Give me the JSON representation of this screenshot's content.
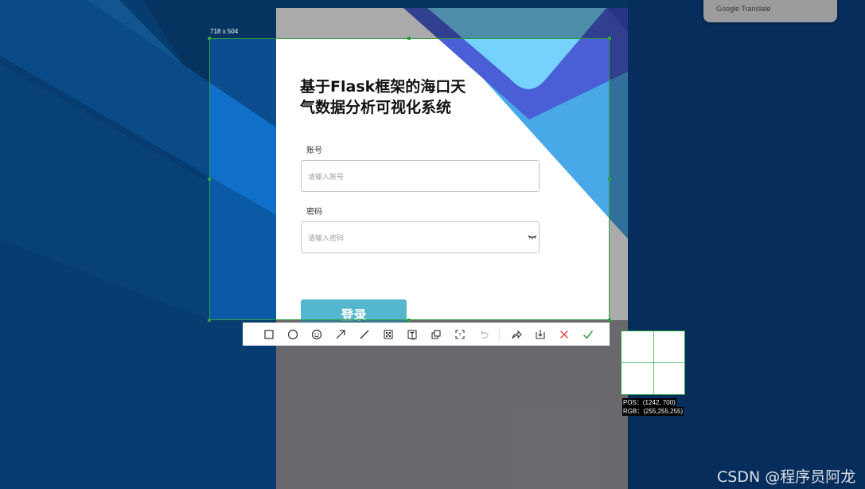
{
  "translate_popup": {
    "label": "Google Translate"
  },
  "login": {
    "title": "基于Flask框架的海口天气数据分析可视化系统",
    "account_label": "账号",
    "account_placeholder": "请输入账号",
    "password_label": "密码",
    "password_placeholder": "请输入密码",
    "submit_label": "登录"
  },
  "capture": {
    "selection_size": "718 x 504",
    "tools": [
      {
        "icon": "rectangle-icon"
      },
      {
        "icon": "ellipse-icon"
      },
      {
        "icon": "emoji-icon"
      },
      {
        "icon": "arrow-icon"
      },
      {
        "icon": "line-icon"
      },
      {
        "icon": "mosaic-icon"
      },
      {
        "icon": "text-icon"
      },
      {
        "icon": "pin-icon"
      },
      {
        "icon": "ocr-icon"
      },
      {
        "icon": "undo-icon"
      },
      {
        "icon": "share-icon"
      },
      {
        "icon": "save-icon"
      },
      {
        "icon": "cancel-icon"
      },
      {
        "icon": "confirm-icon"
      }
    ],
    "pos_readout": "POS：(1242, 700)",
    "rgb_readout": "RGB：(255,255,255)"
  },
  "watermark": "CSDN @程序员阿龙",
  "colors": {
    "selection_border": "#2ea043",
    "button": "#55b6d0",
    "cancel": "#e04848",
    "confirm": "#2ea043"
  }
}
